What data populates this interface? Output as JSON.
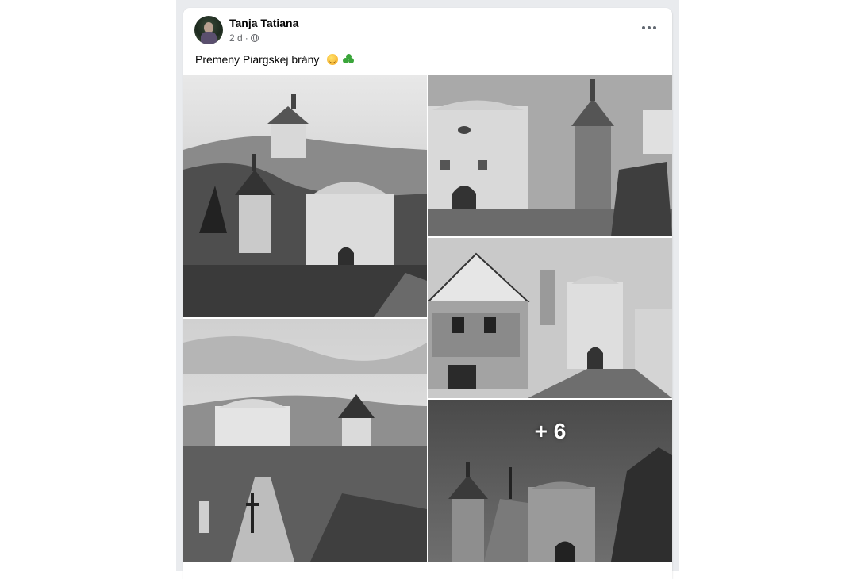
{
  "post": {
    "author": "Tanja Tatiana",
    "time": "2 d",
    "separator": "·",
    "caption": "Premeny Piargskej brány",
    "caption_emojis": [
      "smiling-face-icon",
      "shamrock-icon"
    ],
    "more_photos_label": "+ 6"
  },
  "colors": {
    "feed_background": "#e9ebee",
    "card_background": "#ffffff",
    "author_text": "#050505",
    "meta_text": "#65676b"
  },
  "photos": [
    {
      "name": "photo-gate-hillside-castle"
    },
    {
      "name": "photo-gate-tower-street"
    },
    {
      "name": "photo-gate-painted-house"
    },
    {
      "name": "photo-gate-cemetery-view"
    },
    {
      "name": "photo-gate-more"
    }
  ]
}
